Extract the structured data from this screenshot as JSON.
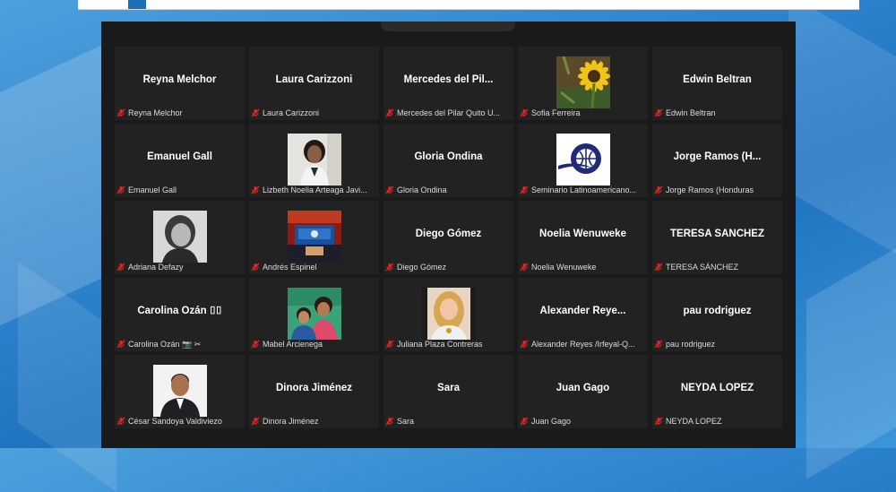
{
  "participants": [
    {
      "display": "Reyna Melchor",
      "label": "Reyna Melchor",
      "video": "none"
    },
    {
      "display": "Laura Carizzoni",
      "label": "Laura Carizzoni",
      "video": "none"
    },
    {
      "display": "Mercedes  del  Pil...",
      "label": "Mercedes del Pilar Quito U...",
      "video": "none"
    },
    {
      "display": "",
      "label": "Sofia Ferreira",
      "video": "sunflower"
    },
    {
      "display": "Edwin Beltran",
      "label": "Edwin Beltran",
      "video": "none"
    },
    {
      "display": "Emanuel Gall",
      "label": "Emanuel Gall",
      "video": "none"
    },
    {
      "display": "",
      "label": "Lizbeth Noelia Arteaga Javi...",
      "video": "woman-portrait"
    },
    {
      "display": "Gloria Ondina",
      "label": "Gloria Ondina",
      "video": "none"
    },
    {
      "display": "",
      "label": "Seminario Latinoamericano...",
      "video": "logo-globe"
    },
    {
      "display": "Jorge Ramos  (H...",
      "label": "Jorge Ramos (Honduras",
      "video": "none"
    },
    {
      "display": "",
      "label": "Adriana Defazy",
      "video": "bw-portrait"
    },
    {
      "display": "",
      "label": "Andrés Espinel",
      "video": "tv-studio"
    },
    {
      "display": "Diego Gómez",
      "label": "Diego Gómez",
      "video": "none"
    },
    {
      "display": "Noelia Wenuweke",
      "label": "Noelia Wenuweke",
      "video": "none"
    },
    {
      "display": "TERESA SÁNCHEZ",
      "label": "TERESA SÁNCHEZ",
      "video": "none"
    },
    {
      "display": "Carolina  Ozán  ⌷⌷",
      "label": "Carolina Ozán 📷 ✂",
      "video": "none"
    },
    {
      "display": "",
      "label": "Mabel Arcienega",
      "video": "family-photo"
    },
    {
      "display": "",
      "label": "Juliana Plaza Contreras",
      "video": "blonde-portrait"
    },
    {
      "display": "Alexander  Reye...",
      "label": "Alexander Reyes /Irfeyal-Q...",
      "video": "none"
    },
    {
      "display": "pau rodriguez",
      "label": "pau rodriguez",
      "video": "none"
    },
    {
      "display": "",
      "label": "César Sandoya Valdiviezo",
      "video": "man-portrait"
    },
    {
      "display": "Dinora Jiménez",
      "label": "Dinora Jiménez",
      "video": "none"
    },
    {
      "display": "Sara",
      "label": "Sara",
      "video": "none"
    },
    {
      "display": "Juan Gago",
      "label": "Juan Gago",
      "video": "none"
    },
    {
      "display": "NEYDA LOPEZ",
      "label": "NEYDA LOPEZ",
      "video": "none"
    }
  ],
  "icons": {
    "muted": "microphone-muted-icon"
  },
  "colors": {
    "tile_bg": "#222222",
    "window_bg": "#1a1a1a",
    "muted_red": "#e02828"
  }
}
